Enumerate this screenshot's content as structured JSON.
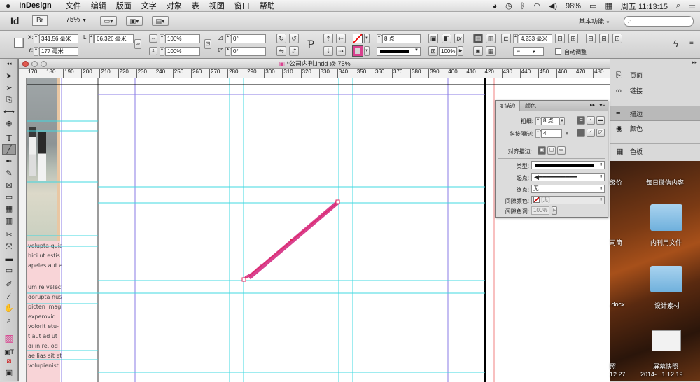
{
  "menubar": {
    "apple": "",
    "app_name": "InDesign",
    "items": [
      "文件",
      "编辑",
      "版面",
      "文字",
      "对象",
      "表",
      "视图",
      "窗口",
      "帮助"
    ],
    "battery": "98%",
    "datetime": "周五 11:13:15"
  },
  "appbar": {
    "logo": "Id",
    "bridge": "Br",
    "zoom": "75%",
    "workspace": "基本功能",
    "search_placeholder": ""
  },
  "control": {
    "x_label": "X:",
    "x_value": "341.56 毫米",
    "y_label": "Y:",
    "y_value": "177 毫米",
    "l_label": "L:",
    "l_value": "66.326 毫米",
    "scale_x": "100%",
    "scale_y": "100%",
    "rotate": "0°",
    "shear": "0°",
    "stroke_weight": "8 点",
    "width_w": "4.233 毫米",
    "opacity": "100%",
    "auto_fit": "自动调整"
  },
  "document": {
    "title": "*公司内刊.indd @ 75%",
    "ruler_ticks": [
      "170",
      "180",
      "190",
      "200",
      "210",
      "220",
      "230",
      "240",
      "250",
      "260",
      "270",
      "280",
      "290",
      "300",
      "310",
      "320",
      "330",
      "340",
      "350",
      "360",
      "370",
      "380",
      "390",
      "400",
      "410",
      "420",
      "430",
      "440",
      "450",
      "460",
      "470",
      "480"
    ],
    "thumb_text": [
      "volupta quiat",
      "hici ut estis",
      "apeles aut ad",
      "",
      "um re velecte",
      "dorupta nus-",
      "picten imag-",
      "experovid",
      "volorit etu-",
      "t aut ad ut",
      "di in re. od",
      "ae lias sit et",
      "volupienist"
    ]
  },
  "dock": {
    "items": [
      "页面",
      "链接",
      "描边",
      "颜色",
      "色板"
    ]
  },
  "desktop": {
    "labels": [
      "每日微信内容",
      "内刊用文件",
      "设计素材",
      "屏幕快照",
      "2014-...1.12.19"
    ],
    "partial_labels": [
      "级价",
      "司简",
      ".docx",
      "照",
      "12.27"
    ]
  },
  "stroke_panel": {
    "tab_stroke": "描边",
    "tab_color": "颜色",
    "weight_label": "粗细:",
    "weight_value": "8 点",
    "miter_label": "斜接限制:",
    "miter_value": "4",
    "miter_unit": "x",
    "align_label": "对齐描边:",
    "type_label": "类型:",
    "start_label": "起点:",
    "end_label": "终点:",
    "end_value": "无",
    "gap_color_label": "间隙颜色:",
    "gap_color_value": "[无]",
    "gap_tint_label": "间隙色调:",
    "gap_tint_value": "100%"
  },
  "colors": {
    "guide": "#40d8e0",
    "margin": "#8a7be6",
    "arrow": "#d9418f",
    "page_edge": "#000000"
  }
}
